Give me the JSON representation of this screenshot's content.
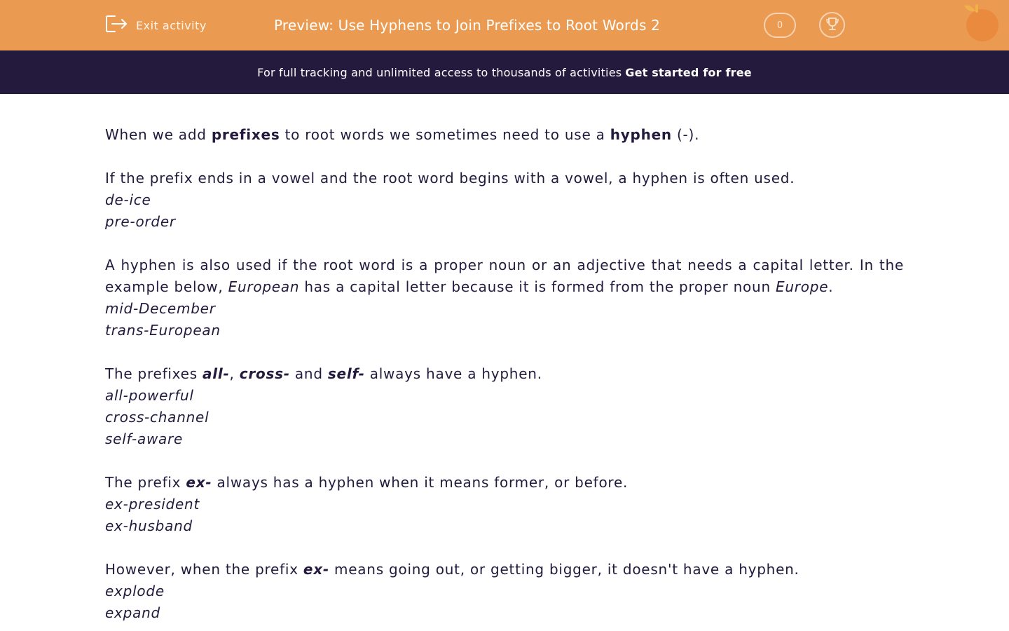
{
  "header": {
    "exit_label": "Exit activity",
    "title": "Preview: Use Hyphens to Join Prefixes to Root Words 2",
    "score": "0",
    "colors": {
      "bar": "#eb9b51",
      "banner": "#231a3d",
      "text": "#231a3d"
    }
  },
  "banner": {
    "text": "For full tracking and unlimited access to thousands of activities",
    "cta": "Get started for free"
  },
  "content": {
    "intro": {
      "t1": "When we add ",
      "b1": "prefixes",
      "t2": " to root words we sometimes need to use a ",
      "b2": "hyphen",
      "t3": " (-)."
    },
    "vowel_rule": "If the prefix ends in a vowel and the root word begins with a vowel, a hyphen is often used.",
    "vowel_examples": [
      "de-ice",
      "pre-order"
    ],
    "proper": {
      "t1": "A hyphen is also used if the root word is a proper noun or an adjective that needs a capital letter. In the example below, ",
      "i1": "European",
      "t2": " has a capital letter because it is formed from the proper noun ",
      "i2": "Europe",
      "t3": "."
    },
    "proper_examples": [
      "mid-December",
      "trans-European"
    ],
    "always": {
      "t1": "The prefixes ",
      "p1": "all-",
      "sep1": ", ",
      "p2": "cross-",
      "sep2": " and ",
      "p3": "self-",
      "t2": " always have a hyphen."
    },
    "always_examples": [
      "all-powerful",
      "cross-channel",
      "self-aware"
    ],
    "ex_former": {
      "t1": "The prefix ",
      "p": "ex-",
      "t2": " always has a hyphen when it means former, or before."
    },
    "ex_former_examples": [
      "ex-president",
      "ex-husband"
    ],
    "ex_out": {
      "t1": "However, when the prefix ",
      "p": "ex-",
      "t2": " means going out, or getting bigger, it doesn't have a hyphen."
    },
    "ex_out_examples": [
      "explode",
      "expand"
    ]
  }
}
